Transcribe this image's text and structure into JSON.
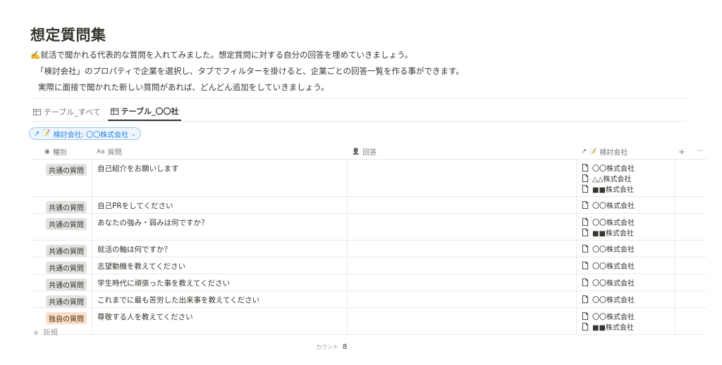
{
  "page": {
    "title": "想定質問集",
    "description": [
      "✍️就活で聞かれる代表的な質問を入れてみました。想定質問に対する自分の回答を埋めていきましょう。",
      "「検討会社」のプロパティで企業を選択し、タブでフィルターを掛けると、企業ごとの回答一覧を作る事ができます。",
      "実際に面接で聞かれた新しい質問があれば、どんどん追加をしていきましょう。"
    ]
  },
  "tabs": [
    {
      "label": "テーブル_すべて",
      "icon": "table-icon",
      "active": false
    },
    {
      "label": "テーブル_〇〇社",
      "icon": "table-icon",
      "active": true
    }
  ],
  "filter": {
    "label": "検討会社: 〇〇株式会社",
    "icon": "relation-arrow-icon",
    "emoji": "📝"
  },
  "columns": {
    "type": {
      "label": "種別",
      "icon": "select-icon"
    },
    "question": {
      "label": "質問",
      "icon": "Aa"
    },
    "answer": {
      "label": "回答",
      "icon": "person-icon"
    },
    "company": {
      "label": "検討会社",
      "icon": "relation-arrow-icon",
      "emoji": "📝"
    },
    "add": "+",
    "more": "···"
  },
  "rows": [
    {
      "type": "共通の質問",
      "tag_color": "gray",
      "question": "自己紹介をお願いします",
      "answer": "",
      "companies": [
        "〇〇株式会社",
        "△△株式会社",
        "■■株式会社"
      ]
    },
    {
      "type": "共通の質問",
      "tag_color": "gray",
      "question": "自己PRをしてください",
      "answer": "",
      "companies": [
        "〇〇株式会社"
      ]
    },
    {
      "type": "共通の質問",
      "tag_color": "gray",
      "question": "あなたの強み・弱みは何ですか？",
      "answer": "",
      "companies": [
        "〇〇株式会社",
        "■■株式会社"
      ]
    },
    {
      "type": "共通の質問",
      "tag_color": "gray",
      "question": "就活の軸は何ですか？",
      "answer": "",
      "companies": [
        "〇〇株式会社"
      ]
    },
    {
      "type": "共通の質問",
      "tag_color": "gray",
      "question": "志望動機を教えてください",
      "answer": "",
      "companies": [
        "〇〇株式会社"
      ]
    },
    {
      "type": "共通の質問",
      "tag_color": "gray",
      "question": "学生時代に頑張った事を教えてください",
      "answer": "",
      "companies": [
        "〇〇株式会社"
      ]
    },
    {
      "type": "共通の質問",
      "tag_color": "gray",
      "question": "これまでに最も苦労した出来事を教えてください",
      "answer": "",
      "companies": [
        "〇〇株式会社"
      ]
    },
    {
      "type": "独自の質問",
      "tag_color": "orange",
      "question": "尊敬する人を教えてください",
      "answer": "",
      "companies": [
        "〇〇株式会社",
        "■■株式会社"
      ]
    }
  ],
  "footer": {
    "new_label": "新規",
    "count_label": "カウント",
    "count_value": "8"
  },
  "colors": {
    "accent": "#2383e2",
    "text": "#37352f",
    "muted": "#787774",
    "border": "#e9e9e7",
    "tag_gray": "#e3e2e0",
    "tag_orange": "#fadec9"
  }
}
